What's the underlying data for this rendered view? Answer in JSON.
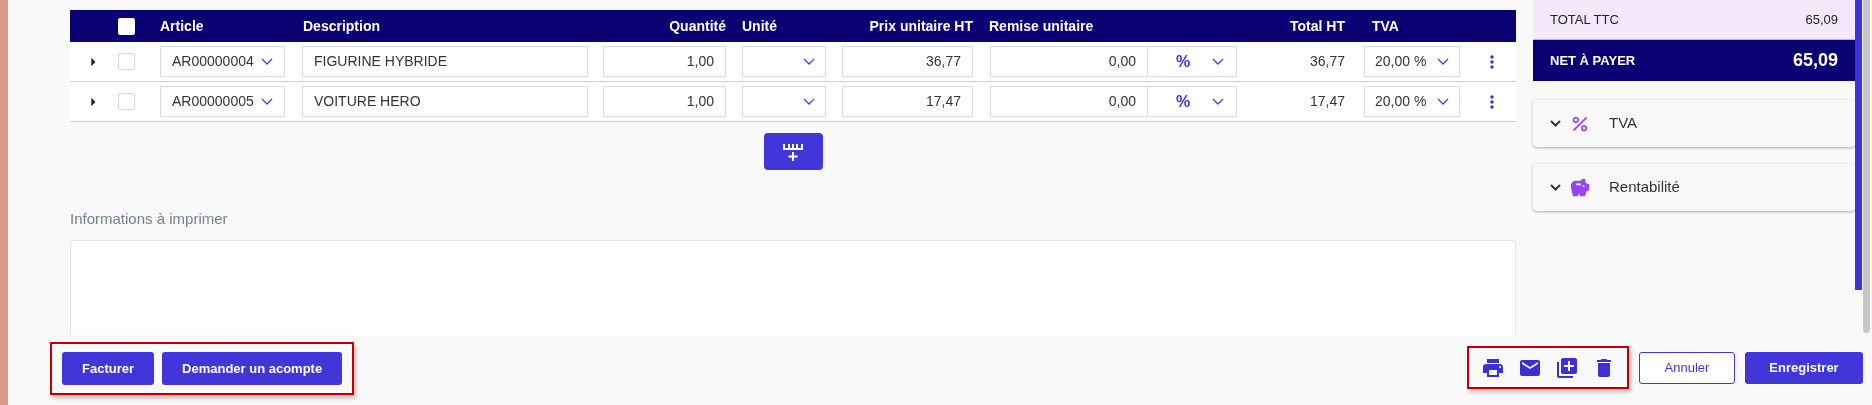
{
  "table": {
    "select_all": {
      "checked": false
    },
    "columns": [
      "Article",
      "Description",
      "Quantité",
      "Unité",
      "Prix unitaire HT",
      "Remise unitaire",
      "Total HT",
      "TVA"
    ],
    "rows": [
      {
        "expanded": false,
        "checked": false,
        "article": "AR00000004",
        "description": "FIGURINE HYBRIDE",
        "quantity": "1,00",
        "unit_price": "36,77",
        "discount": "0,00",
        "discount_type": "%",
        "total_ht": "36,77",
        "vat": "20,00 %"
      },
      {
        "expanded": false,
        "checked": false,
        "article": "AR00000005",
        "description": "VOITURE HERO",
        "quantity": "1,00",
        "unit_price": "17,47",
        "discount": "0,00",
        "discount_type": "%",
        "total_ht": "17,47",
        "vat": "20,00 %"
      }
    ]
  },
  "print_info": {
    "label": "Informations à imprimer"
  },
  "summary": {
    "total_ttc": {
      "label": "TOTAL TTC",
      "value": "65,09"
    },
    "net": {
      "label": "NET À PAYER",
      "value": "65,09"
    },
    "sections": [
      {
        "kind": "vat",
        "label": "TVA",
        "expanded": false
      },
      {
        "kind": "profit",
        "label": "Rentabilité",
        "expanded": false
      }
    ]
  },
  "footer": {
    "left_buttons": [
      "Facturer",
      "Demander un acompte"
    ],
    "icon_buttons": [
      {
        "kind": "print"
      },
      {
        "kind": "mail"
      },
      {
        "kind": "duplicate"
      },
      {
        "kind": "delete"
      }
    ],
    "cancel": "Annuler",
    "save": "Enregistrer"
  }
}
